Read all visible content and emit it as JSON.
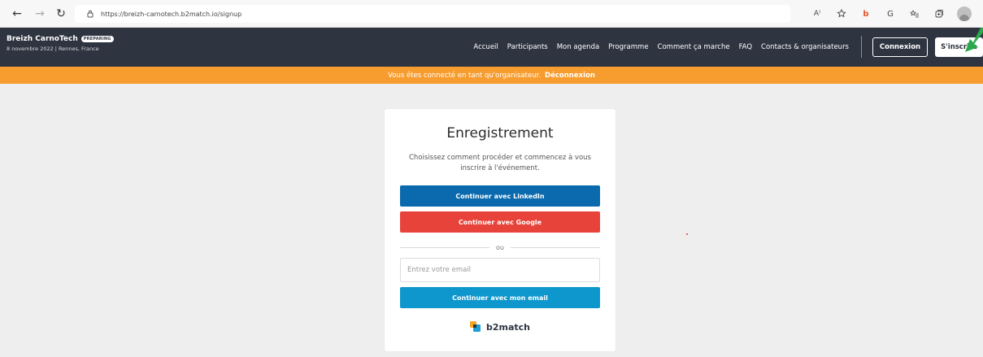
{
  "browser": {
    "url": "https://breizh-carnotech.b2match.io/signup",
    "tools": [
      "read-aloud-icon",
      "favorites-add-icon",
      "extension-icon",
      "extension-g-icon",
      "favorites-icon",
      "collections-icon",
      "profile-icon"
    ],
    "read_aloud_label": "A⁾",
    "extension_b_label": "b",
    "extension_g_label": "G"
  },
  "header": {
    "event_name": "Breizh CarnoTech",
    "status_badge": "PREPARING",
    "event_subtitle": "8 novembre 2022 | Rennes, France",
    "nav": [
      "Accueil",
      "Participants",
      "Mon agenda",
      "Programme",
      "Comment ça marche",
      "FAQ",
      "Contacts & organisateurs"
    ],
    "login_label": "Connexion",
    "signup_label": "S'inscrire"
  },
  "notice": {
    "text": "Vous êtes connecté en tant qu'organisateur.",
    "logout_label": "Déconnexion"
  },
  "signup": {
    "title": "Enregistrement",
    "description": "Choisissez comment procéder et commencez à vous inscrire à l'événement.",
    "linkedin_label": "Continuer avec LinkedIn",
    "google_label": "Continuer avec Google",
    "or_label": "ou",
    "email_placeholder": "Entrez votre email",
    "email_value": "",
    "email_button_label": "Continuer avec mon email",
    "brand": "b2match"
  },
  "colors": {
    "header_bg": "#2e3440",
    "notice_bg": "#f79c2e",
    "linkedin": "#0a6aad",
    "google": "#e8433a",
    "email_button": "#0e97cc",
    "page_bg": "#eeeeee"
  }
}
